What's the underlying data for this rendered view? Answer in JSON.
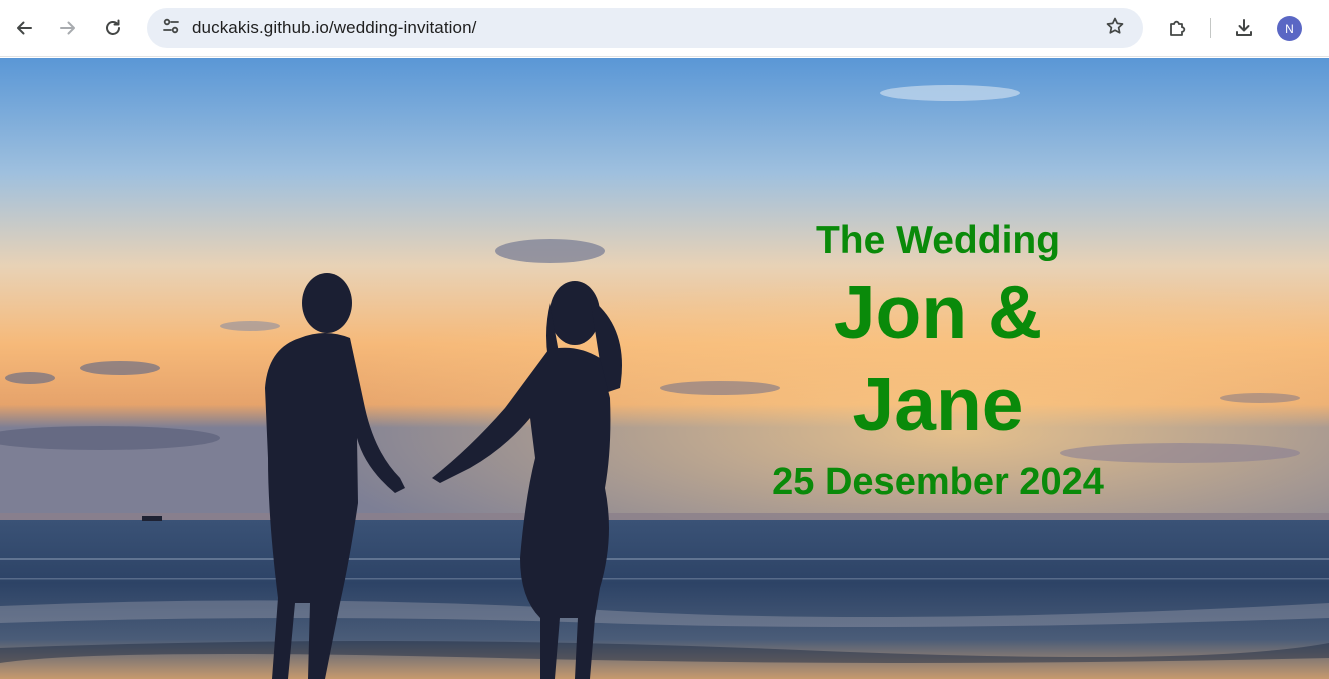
{
  "browser": {
    "url": "duckakis.github.io/wedding-invitation/",
    "profile_initial": "N",
    "icons": {
      "back": "arrow-left-icon",
      "forward": "arrow-right-icon",
      "reload": "reload-icon",
      "site_info": "tune-icon",
      "bookmark": "star-icon",
      "extensions": "puzzle-icon",
      "downloads": "download-icon"
    }
  },
  "hero": {
    "subtitle": "The Wedding",
    "names_line1": "Jon &",
    "names_line2": "Jane",
    "date": "25 Desember 2024",
    "text_color": "#0a8a0a"
  }
}
